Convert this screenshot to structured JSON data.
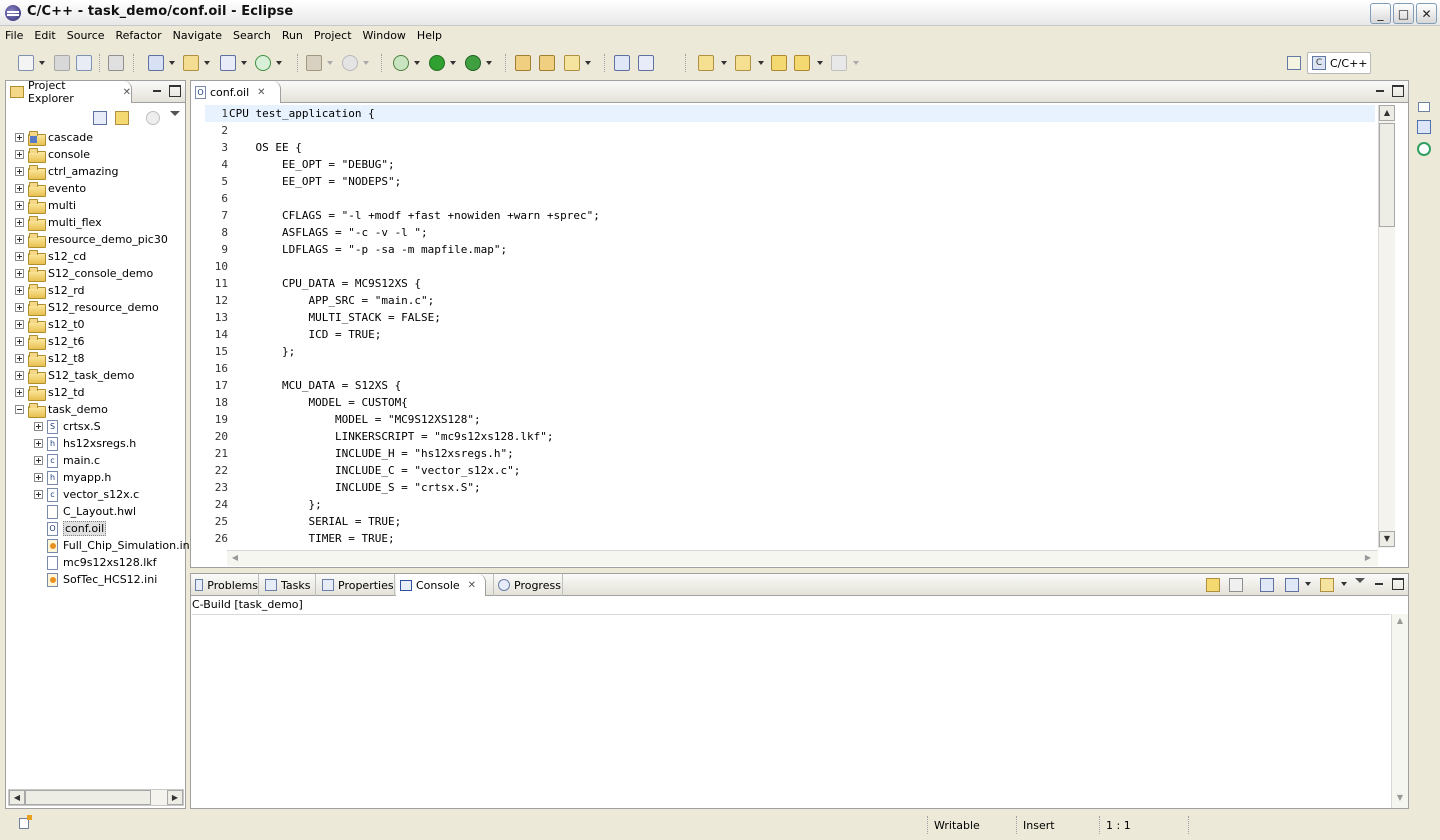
{
  "window": {
    "title": "C/C++ - task_demo/conf.oil - Eclipse",
    "min_label": "_",
    "max_label": "□",
    "close_label": "✕"
  },
  "menu": [
    "File",
    "Edit",
    "Source",
    "Refactor",
    "Navigate",
    "Search",
    "Run",
    "Project",
    "Window",
    "Help"
  ],
  "perspective": {
    "label": "C/C++",
    "icon": "c-perspective-icon"
  },
  "project_explorer": {
    "title": "Project Explorer",
    "items": [
      {
        "label": "cascade",
        "type": "cproject",
        "expanded": false,
        "level": 0
      },
      {
        "label": "console",
        "type": "project",
        "expanded": false,
        "level": 0
      },
      {
        "label": "ctrl_amazing",
        "type": "project",
        "expanded": false,
        "level": 0
      },
      {
        "label": "evento",
        "type": "project",
        "expanded": false,
        "level": 0
      },
      {
        "label": "multi",
        "type": "project",
        "expanded": false,
        "level": 0
      },
      {
        "label": "multi_flex",
        "type": "project",
        "expanded": false,
        "level": 0
      },
      {
        "label": "resource_demo_pic30",
        "type": "project",
        "expanded": false,
        "level": 0
      },
      {
        "label": "s12_cd",
        "type": "project",
        "expanded": false,
        "level": 0
      },
      {
        "label": "S12_console_demo",
        "type": "project",
        "expanded": false,
        "level": 0
      },
      {
        "label": "s12_rd",
        "type": "project",
        "expanded": false,
        "level": 0
      },
      {
        "label": "S12_resource_demo",
        "type": "project",
        "expanded": false,
        "level": 0
      },
      {
        "label": "s12_t0",
        "type": "project",
        "expanded": false,
        "level": 0
      },
      {
        "label": "s12_t6",
        "type": "project",
        "expanded": false,
        "level": 0
      },
      {
        "label": "s12_t8",
        "type": "project",
        "expanded": false,
        "level": 0
      },
      {
        "label": "S12_task_demo",
        "type": "project",
        "expanded": false,
        "level": 0
      },
      {
        "label": "s12_td",
        "type": "project",
        "expanded": false,
        "level": 0
      },
      {
        "label": "task_demo",
        "type": "project",
        "expanded": true,
        "level": 0
      },
      {
        "label": "crtsx.S",
        "type": "file",
        "glyph": "S",
        "expandable": true,
        "level": 1
      },
      {
        "label": "hs12xsregs.h",
        "type": "file",
        "glyph": "h",
        "expandable": true,
        "level": 1
      },
      {
        "label": "main.c",
        "type": "file",
        "glyph": "c",
        "expandable": true,
        "level": 1
      },
      {
        "label": "myapp.h",
        "type": "file",
        "glyph": "h",
        "expandable": true,
        "level": 1
      },
      {
        "label": "vector_s12x.c",
        "type": "file",
        "glyph": "c",
        "expandable": true,
        "level": 1
      },
      {
        "label": "C_Layout.hwl",
        "type": "file",
        "glyph": "",
        "expandable": false,
        "level": 1
      },
      {
        "label": "conf.oil",
        "type": "file",
        "glyph": "O",
        "expandable": false,
        "level": 1,
        "selected": true
      },
      {
        "label": "Full_Chip_Simulation.ini",
        "type": "ini",
        "glyph": "",
        "expandable": false,
        "level": 1
      },
      {
        "label": "mc9s12xs128.lkf",
        "type": "file",
        "glyph": "",
        "expandable": false,
        "level": 1
      },
      {
        "label": "SofTec_HCS12.ini",
        "type": "ini",
        "glyph": "",
        "expandable": false,
        "level": 1
      }
    ]
  },
  "editor": {
    "tab_label": "conf.oil",
    "tab_icon": "oil-file-icon",
    "lines": [
      {
        "n": "1",
        "text": "CPU test_application {"
      },
      {
        "n": "2",
        "text": ""
      },
      {
        "n": "3",
        "text": "    OS EE {"
      },
      {
        "n": "4",
        "text": "        EE_OPT = \"DEBUG\";"
      },
      {
        "n": "5",
        "text": "        EE_OPT = \"NODEPS\";"
      },
      {
        "n": "6",
        "text": ""
      },
      {
        "n": "7",
        "text": "        CFLAGS = \"-l +modf +fast +nowiden +warn +sprec\";"
      },
      {
        "n": "8",
        "text": "        ASFLAGS = \"-c -v -l \";"
      },
      {
        "n": "9",
        "text": "        LDFLAGS = \"-p -sa -m mapfile.map\";"
      },
      {
        "n": "10",
        "text": ""
      },
      {
        "n": "11",
        "text": "        CPU_DATA = MC9S12XS {"
      },
      {
        "n": "12",
        "text": "            APP_SRC = \"main.c\";"
      },
      {
        "n": "13",
        "text": "            MULTI_STACK = FALSE;"
      },
      {
        "n": "14",
        "text": "            ICD = TRUE;"
      },
      {
        "n": "15",
        "text": "        };"
      },
      {
        "n": "16",
        "text": ""
      },
      {
        "n": "17",
        "text": "        MCU_DATA = S12XS {"
      },
      {
        "n": "18",
        "text": "            MODEL = CUSTOM{"
      },
      {
        "n": "19",
        "text": "                MODEL = \"MC9S12XS128\";"
      },
      {
        "n": "20",
        "text": "                LINKERSCRIPT = \"mc9s12xs128.lkf\";"
      },
      {
        "n": "21",
        "text": "                INCLUDE_H = \"hs12xsregs.h\";"
      },
      {
        "n": "22",
        "text": "                INCLUDE_C = \"vector_s12x.c\";"
      },
      {
        "n": "23",
        "text": "                INCLUDE_S = \"crtsx.S\";"
      },
      {
        "n": "24",
        "text": "            };"
      },
      {
        "n": "25",
        "text": "            SERIAL = TRUE;"
      },
      {
        "n": "26",
        "text": "            TIMER = TRUE;"
      }
    ]
  },
  "bottom": {
    "tabs": [
      {
        "label": "Problems",
        "icon": "problems-icon"
      },
      {
        "label": "Tasks",
        "icon": "tasks-icon"
      },
      {
        "label": "Properties",
        "icon": "properties-icon"
      },
      {
        "label": "Console",
        "icon": "console-icon",
        "active": true
      },
      {
        "label": "Progress",
        "icon": "progress-icon"
      }
    ],
    "console_header": "C-Build [task_demo]"
  },
  "status": {
    "writable": "Writable",
    "insert": "Insert",
    "position": "1 : 1"
  },
  "colors": {
    "chrome": "#ECE9D8",
    "current_line": "#E8F2FE",
    "selection": "#E0E0E0"
  }
}
